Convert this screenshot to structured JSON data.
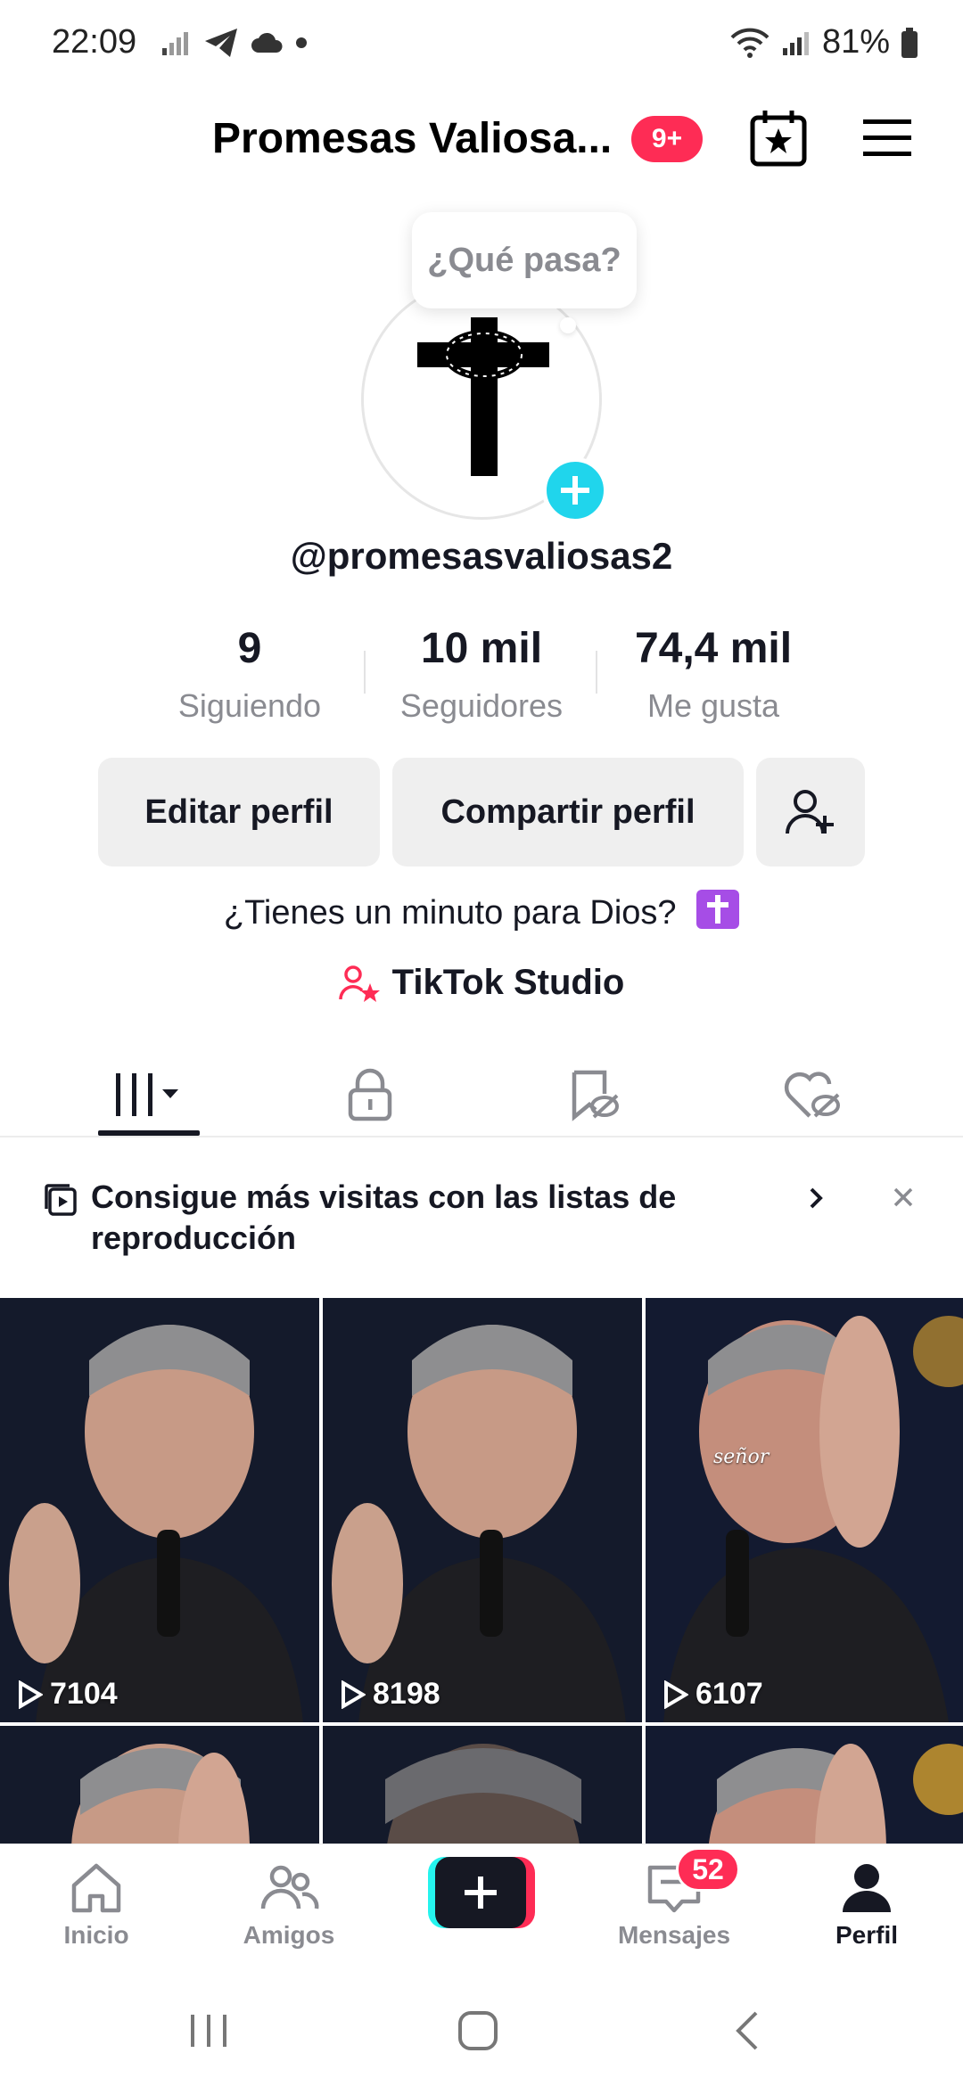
{
  "status_bar": {
    "time": "22:09",
    "battery": "81%",
    "icons_left": [
      "signal-off-icon",
      "telegram-icon",
      "cloud-icon",
      "dot-icon"
    ],
    "icons_right": [
      "wifi-icon",
      "signal-icon",
      "battery-icon"
    ]
  },
  "header": {
    "account_name": "Promesas Valiosa...",
    "notification_badge": "9+",
    "icons": [
      "calendar-star-icon",
      "menu-icon"
    ]
  },
  "profile": {
    "bubble_text": "¿Qué pasa?",
    "username": "@promesasvaliosas2",
    "stats": [
      {
        "value": "9",
        "label": "Siguiendo"
      },
      {
        "value": "10 mil",
        "label": "Seguidores"
      },
      {
        "value": "74,4 mil",
        "label": "Me gusta"
      }
    ],
    "buttons": {
      "edit": "Editar perfil",
      "share": "Compartir perfil"
    },
    "bio": "¿Tienes un minuto para Dios?",
    "studio": "TikTok Studio"
  },
  "tabs": [
    "videos-grid-icon",
    "lock-icon",
    "saved-icon",
    "liked-icon"
  ],
  "banner": {
    "text": "Consigue más visitas con las listas de reproducción"
  },
  "videos": [
    {
      "views": "7104"
    },
    {
      "views": "8198"
    },
    {
      "views": "6107",
      "caption": "señor"
    }
  ],
  "bottom_nav": {
    "items": [
      {
        "label": "Inicio"
      },
      {
        "label": "Amigos"
      },
      {
        "label": "Mensajes"
      },
      {
        "label": "Perfil"
      }
    ],
    "messages_badge": "52"
  },
  "colors": {
    "accent": "#fe2c55",
    "cyan": "#25f4ee",
    "avatar_add": "#20d5ec",
    "text_primary": "#161823",
    "text_secondary": "#8a8b91"
  }
}
